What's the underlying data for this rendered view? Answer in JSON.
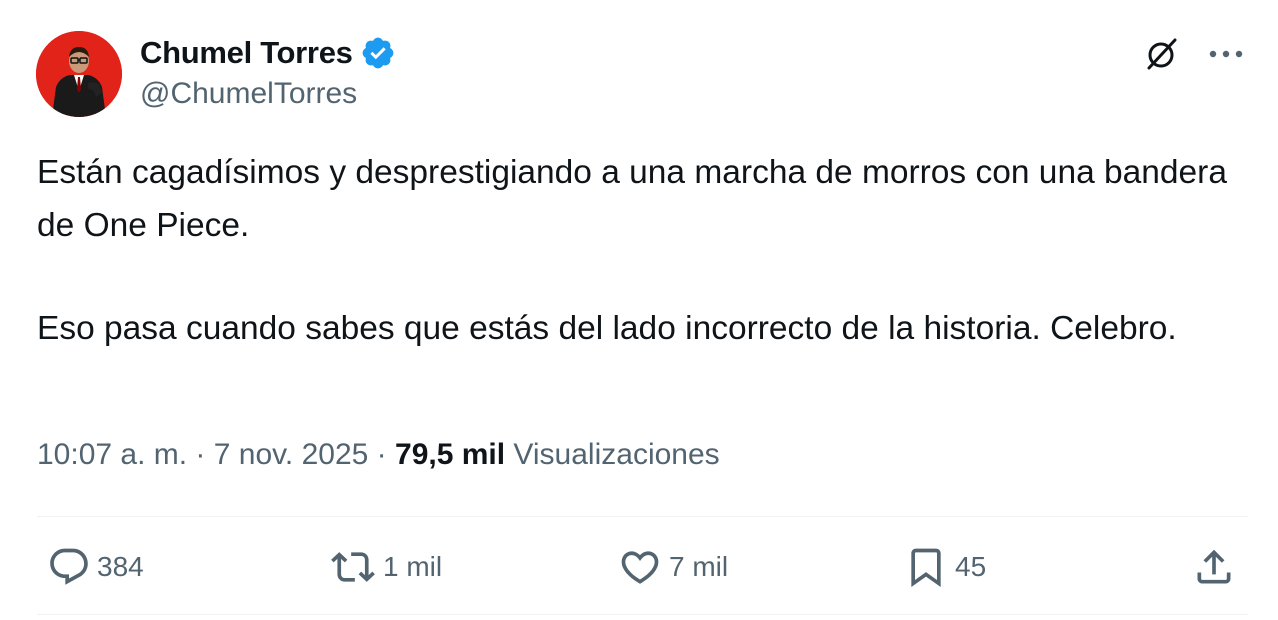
{
  "author": {
    "display_name": "Chumel Torres",
    "handle": "@ChumelTorres",
    "verified_icon": "verified-badge-icon"
  },
  "top_actions": {
    "grok_icon": "grok-icon",
    "more_icon": "more-icon"
  },
  "tweet": {
    "paragraphs": [
      "Están cagadísimos y desprestigiando a una marcha de morros con una bandera de One Piece.",
      "Eso pasa cuando sabes que estás del lado incorrecto de la historia. Celebro."
    ]
  },
  "meta": {
    "time": "10:07 a. m.",
    "sep1": " · ",
    "date": "7 nov. 2025",
    "sep2": " · ",
    "views_count": "79,5 mil",
    "views_label": " Visualizaciones"
  },
  "actions": {
    "replies": "384",
    "reposts": "1 mil",
    "likes": "7 mil",
    "bookmarks": "45"
  },
  "colors": {
    "text_primary": "#0f1419",
    "text_secondary": "#536471",
    "verified_blue": "#1d9bf0",
    "avatar_bg": "#e2231a"
  }
}
